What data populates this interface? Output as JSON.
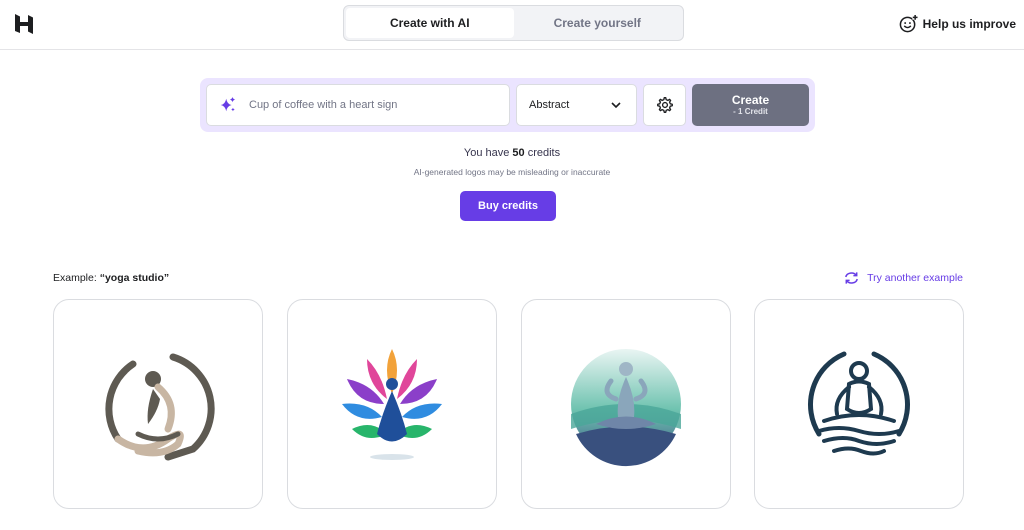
{
  "header": {
    "tabs": [
      {
        "label": "Create with AI",
        "active": true
      },
      {
        "label": "Create yourself",
        "active": false
      }
    ],
    "help_label": "Help us improve"
  },
  "prompt": {
    "placeholder": "Cup of coffee with a heart sign",
    "value": "",
    "style_value": "Abstract",
    "create_label": "Create",
    "create_cost": "- 1 Credit"
  },
  "credits": {
    "prefix": "You have ",
    "amount": "50",
    "suffix": " credits",
    "disclaimer": "AI-generated logos may be misleading or inaccurate",
    "buy_label": "Buy credits"
  },
  "example": {
    "prefix": "Example: ",
    "query": "“yoga studio”",
    "try_another": "Try another example"
  },
  "colors": {
    "accent": "#673de6",
    "prompt_bg": "#ebe4ff",
    "create_bg": "#6d7081"
  },
  "icons": {
    "logo": "hostinger-h-icon",
    "help": "smiley-plus-icon",
    "sparkle": "sparkles-icon",
    "dropdown": "chevron-down-icon",
    "settings": "gear-icon",
    "refresh": "refresh-icon"
  }
}
